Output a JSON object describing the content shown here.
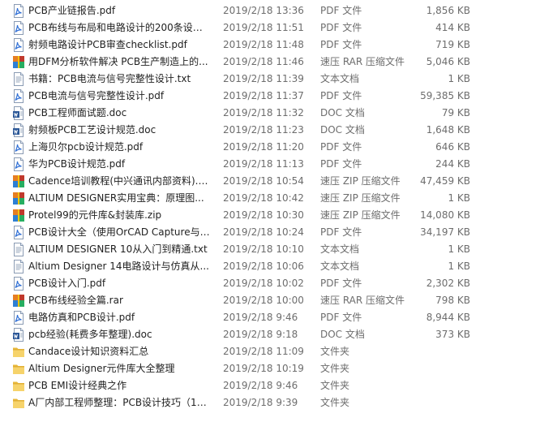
{
  "rows": [
    {
      "icon": "pdf-icon",
      "name": "PCB产业链报告.pdf",
      "date": "2019/2/18 13:36",
      "type": "PDF 文件",
      "size": "1,856 KB"
    },
    {
      "icon": "pdf-icon",
      "name": "PCB布线与布局和电路设计的200条设计...",
      "date": "2019/2/18 11:51",
      "type": "PDF 文件",
      "size": "414 KB"
    },
    {
      "icon": "pdf-icon",
      "name": "射频电路设计PCB审查checklist.pdf",
      "date": "2019/2/18 11:48",
      "type": "PDF 文件",
      "size": "719 KB"
    },
    {
      "icon": "rar-icon",
      "name": "用DFM分析软件解决 PCB生产制造上的...",
      "date": "2019/2/18 11:46",
      "type": "速压 RAR 压缩文件",
      "size": "5,046 KB"
    },
    {
      "icon": "txt-icon",
      "name": "书籍：PCB电流与信号完整性设计.txt",
      "date": "2019/2/18 11:39",
      "type": "文本文档",
      "size": "1 KB"
    },
    {
      "icon": "pdf-icon",
      "name": "PCB电流与信号完整性设计.pdf",
      "date": "2019/2/18 11:37",
      "type": "PDF 文件",
      "size": "59,385 KB"
    },
    {
      "icon": "doc-icon",
      "name": "PCB工程师面试题.doc",
      "date": "2019/2/18 11:32",
      "type": "DOC 文档",
      "size": "79 KB"
    },
    {
      "icon": "doc-icon",
      "name": "射频板PCB工艺设计规范.doc",
      "date": "2019/2/18 11:23",
      "type": "DOC 文档",
      "size": "1,648 KB"
    },
    {
      "icon": "pdf-icon",
      "name": "上海贝尔pcb设计规范.pdf",
      "date": "2019/2/18 11:20",
      "type": "PDF 文件",
      "size": "646 KB"
    },
    {
      "icon": "pdf-icon",
      "name": "华为PCB设计规范.pdf",
      "date": "2019/2/18 11:13",
      "type": "PDF 文件",
      "size": "244 KB"
    },
    {
      "icon": "zip-icon",
      "name": "Cadence培训教程(中兴通讯内部资料).zip",
      "date": "2019/2/18 10:54",
      "type": "速压 ZIP 压缩文件",
      "size": "47,459 KB"
    },
    {
      "icon": "zip-icon",
      "name": "ALTIUM DESIGNER实用宝典：原理图...",
      "date": "2019/2/18 10:42",
      "type": "速压 ZIP 压缩文件",
      "size": "1 KB"
    },
    {
      "icon": "zip-icon",
      "name": "Protel99的元件库&封装库.zip",
      "date": "2019/2/18 10:30",
      "type": "速压 ZIP 压缩文件",
      "size": "14,080 KB"
    },
    {
      "icon": "pdf-icon",
      "name": "PCB设计大全（使用OrCAD Capture与P...",
      "date": "2019/2/18 10:24",
      "type": "PDF 文件",
      "size": "34,197 KB"
    },
    {
      "icon": "txt-icon",
      "name": "ALTIUM DESIGNER 10从入门到精通.txt",
      "date": "2019/2/18 10:10",
      "type": "文本文档",
      "size": "1 KB"
    },
    {
      "icon": "txt-icon",
      "name": "Altium Designer 14电路设计与仿真从...",
      "date": "2019/2/18 10:06",
      "type": "文本文档",
      "size": "1 KB"
    },
    {
      "icon": "pdf-icon",
      "name": "PCB设计入门.pdf",
      "date": "2019/2/18 10:02",
      "type": "PDF 文件",
      "size": "2,302 KB"
    },
    {
      "icon": "rar-icon",
      "name": "PCB布线经验全篇.rar",
      "date": "2019/2/18 10:00",
      "type": "速压 RAR 压缩文件",
      "size": "798 KB"
    },
    {
      "icon": "pdf-icon",
      "name": "电路仿真和PCB设计.pdf",
      "date": "2019/2/18 9:46",
      "type": "PDF 文件",
      "size": "8,944 KB"
    },
    {
      "icon": "doc-icon",
      "name": "pcb经验(耗费多年整理).doc",
      "date": "2019/2/18 9:18",
      "type": "DOC 文档",
      "size": "373 KB"
    },
    {
      "icon": "folder-icon",
      "name": "Candace设计知识资料汇总",
      "date": "2019/2/18 11:09",
      "type": "文件夹",
      "size": ""
    },
    {
      "icon": "folder-icon",
      "name": "Altium Designer元件库大全整理",
      "date": "2019/2/18 10:19",
      "type": "文件夹",
      "size": ""
    },
    {
      "icon": "folder-icon",
      "name": "PCB EMI设计经典之作",
      "date": "2019/2/18 9:46",
      "type": "文件夹",
      "size": ""
    },
    {
      "icon": "folder-icon",
      "name": "A厂内部工程师整理：PCB设计技巧（11...",
      "date": "2019/2/18 9:39",
      "type": "文件夹",
      "size": ""
    }
  ]
}
